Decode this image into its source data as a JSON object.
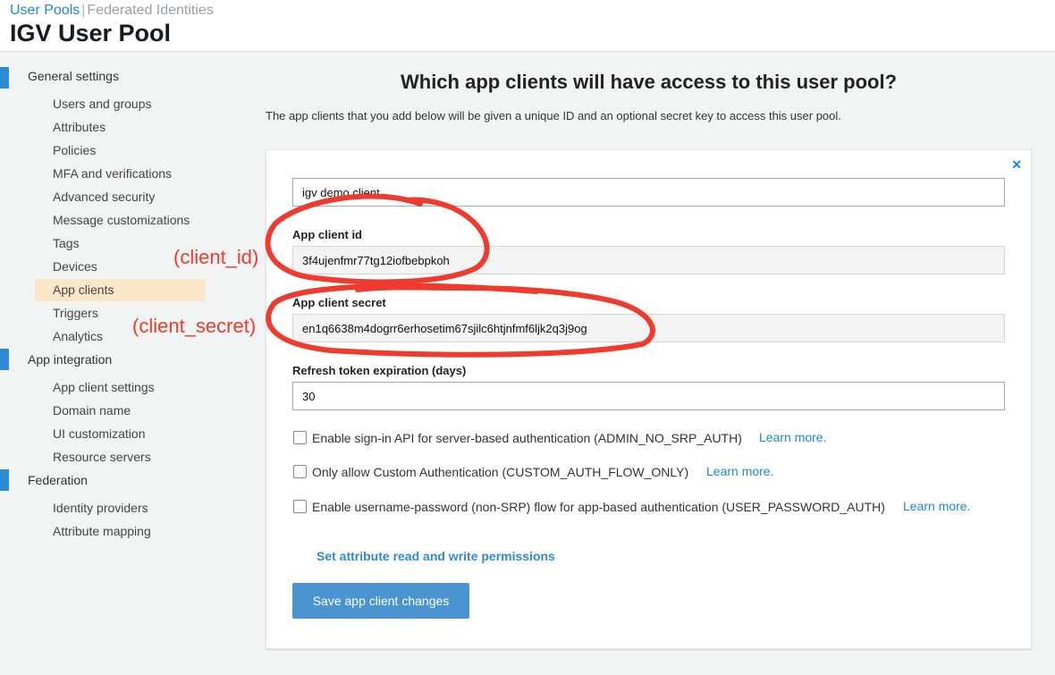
{
  "header": {
    "tab_user_pools": "User Pools",
    "tab_separator": "|",
    "tab_federated": "Federated Identities",
    "title": "IGV User Pool"
  },
  "sidebar": {
    "general_settings": "General settings",
    "general_items": [
      "Users and groups",
      "Attributes",
      "Policies",
      "MFA and verifications",
      "Advanced security",
      "Message customizations",
      "Tags",
      "Devices",
      "App clients",
      "Triggers",
      "Analytics"
    ],
    "active_item": "App clients",
    "app_integration": "App integration",
    "app_integration_items": [
      "App client settings",
      "Domain name",
      "UI customization",
      "Resource servers"
    ],
    "federation": "Federation",
    "federation_items": [
      "Identity providers",
      "Attribute mapping"
    ]
  },
  "annotations": {
    "client_id": "(client_id)",
    "client_secret": "(client_secret)"
  },
  "main": {
    "heading": "Which app clients will have access to this user pool?",
    "description": "The app clients that you add below will be given a unique ID and an optional secret key to access this user pool.",
    "close_icon": "close-icon",
    "client_name_value": "igv demo client",
    "app_client_id_label": "App client id",
    "app_client_id_value": "3f4ujenfmr77tg12iofbebpkoh",
    "app_client_secret_label": "App client secret",
    "app_client_secret_value": "en1q6638m4dogrr6erhosetim67sjilc6htjnfmf6ljk2q3j9og",
    "refresh_label": "Refresh token expiration (days)",
    "refresh_value": "30",
    "checkboxes": [
      {
        "label": "Enable sign-in API for server-based authentication (ADMIN_NO_SRP_AUTH)",
        "link": "Learn more.",
        "checked": false
      },
      {
        "label": "Only allow Custom Authentication (CUSTOM_AUTH_FLOW_ONLY)",
        "link": "Learn more.",
        "checked": false
      },
      {
        "label": "Enable username-password (non-SRP) flow for app-based authentication (USER_PASSWORD_AUTH)",
        "link": "Learn more.",
        "checked": false
      }
    ],
    "attr_link": "Set attribute read and write permissions",
    "save_button": "Save app client changes"
  },
  "colors": {
    "accent": "#1b8ad6",
    "button": "#4a95d1",
    "sidebar_bar": "#2e8ad8",
    "active_bg": "#fce6c8",
    "annotation": "#f03a2e"
  }
}
